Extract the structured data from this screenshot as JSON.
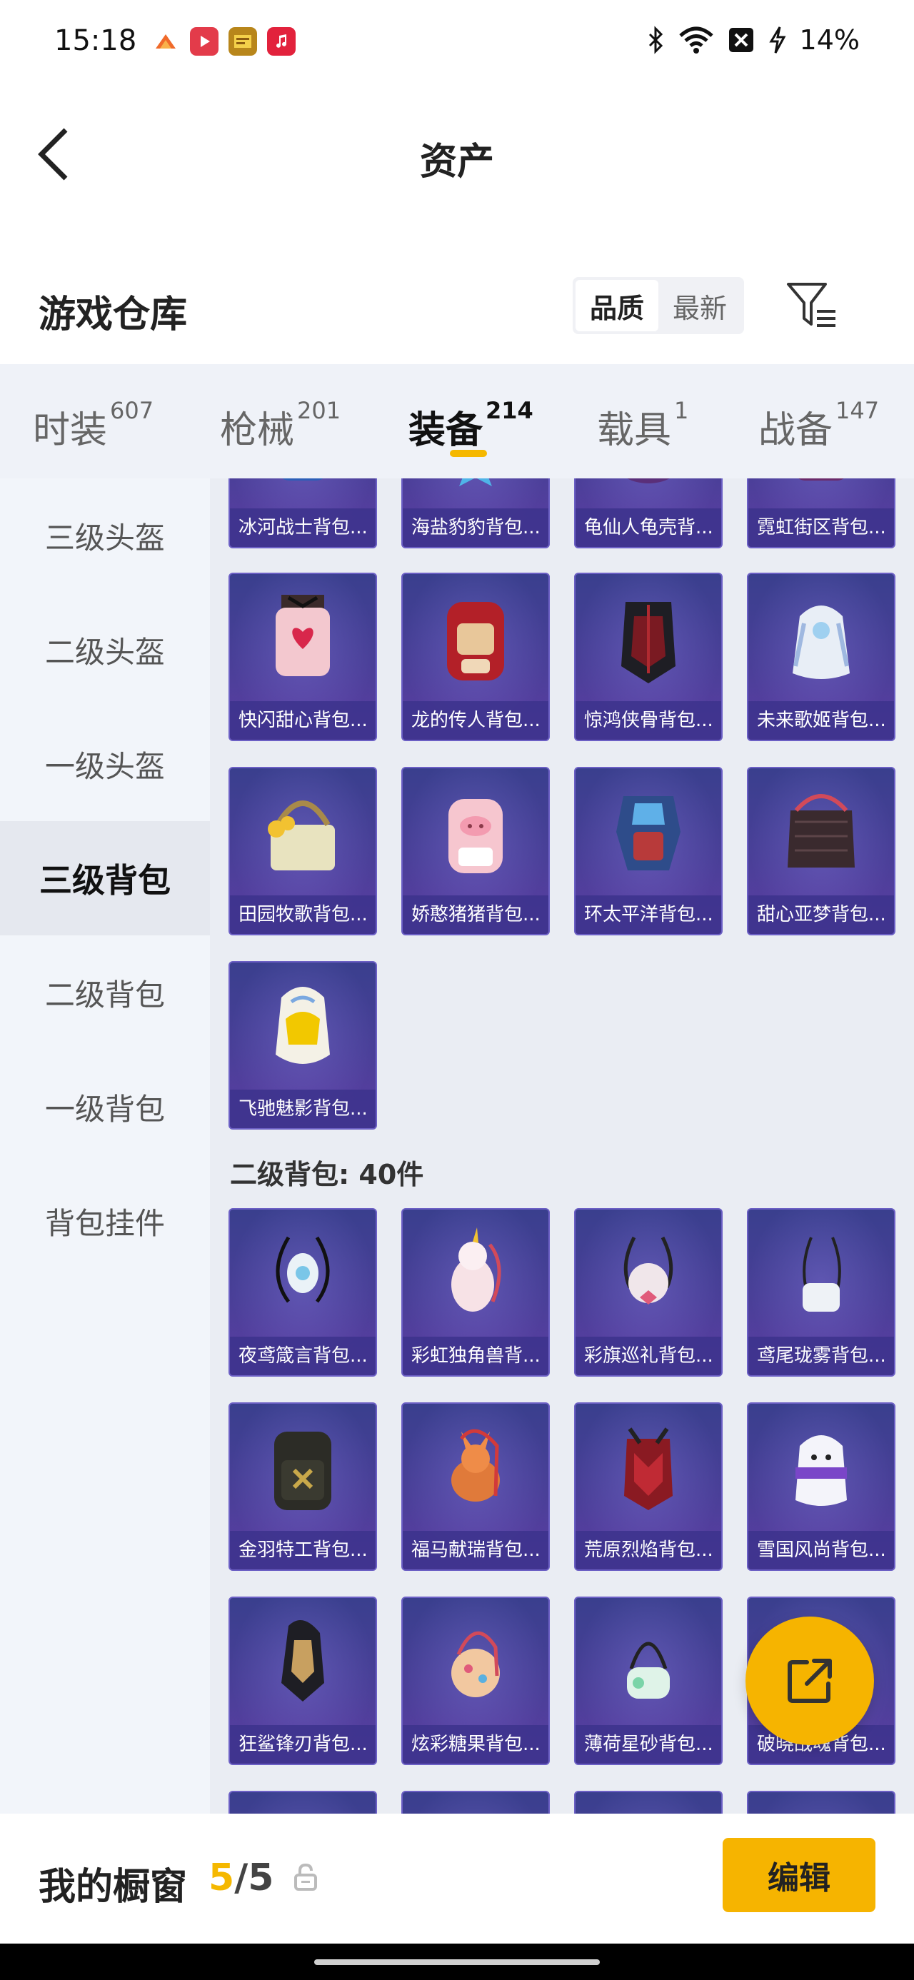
{
  "status_bar": {
    "time": "15:18",
    "battery": "14%",
    "icons": [
      "game-icon",
      "video-icon",
      "news-icon",
      "music-icon",
      "bluetooth-icon",
      "wifi-icon",
      "sim-off-icon",
      "charging-icon"
    ]
  },
  "nav": {
    "title": "资产"
  },
  "section": {
    "title": "游戏仓库",
    "sort_options": [
      "品质",
      "最新"
    ],
    "sort_selected": "品质"
  },
  "tabs": [
    {
      "label": "时装",
      "count": "607"
    },
    {
      "label": "枪械",
      "count": "201"
    },
    {
      "label": "装备",
      "count": "214"
    },
    {
      "label": "载具",
      "count": "1"
    },
    {
      "label": "战备",
      "count": "147"
    }
  ],
  "active_tab": "装备",
  "sidebar": {
    "items": [
      "三级头盔",
      "二级头盔",
      "一级头盔",
      "三级背包",
      "二级背包",
      "一级背包",
      "背包挂件"
    ],
    "active": "三级背包"
  },
  "groups": {
    "level3": {
      "row0": [
        "冰河战士背包...",
        "海盐豹豹背包...",
        "龟仙人龟壳背...",
        "霓虹街区背包..."
      ],
      "row1": [
        "快闪甜心背包...",
        "龙的传人背包...",
        "惊鸿侠骨背包...",
        "未来歌姬背包..."
      ],
      "row2": [
        "田园牧歌背包...",
        "娇憨猪猪背包...",
        "环太平洋背包...",
        "甜心亚梦背包..."
      ],
      "row3": [
        "飞驰魅影背包..."
      ]
    },
    "level2": {
      "title": "二级背包: 40件",
      "row0": [
        "夜鸢箴言背包...",
        "彩虹独角兽背...",
        "彩旗巡礼背包...",
        "鸢尾珑雾背包..."
      ],
      "row1": [
        "金羽特工背包...",
        "福马献瑞背包...",
        "荒原烈焰背包...",
        "雪国风尚背包..."
      ],
      "row2": [
        "狂鲨锋刃背包...",
        "炫彩糖果背包...",
        "薄荷星砂背包...",
        "破晓战魂背包..."
      ]
    }
  },
  "bottom": {
    "title": "我的橱窗",
    "count_current": "5",
    "count_sep": "/",
    "count_total": "5",
    "edit_label": "编辑"
  },
  "colors": {
    "accent": "#f5b800",
    "card_bg": "#4a3f98",
    "card_border": "#6b5fc4"
  }
}
